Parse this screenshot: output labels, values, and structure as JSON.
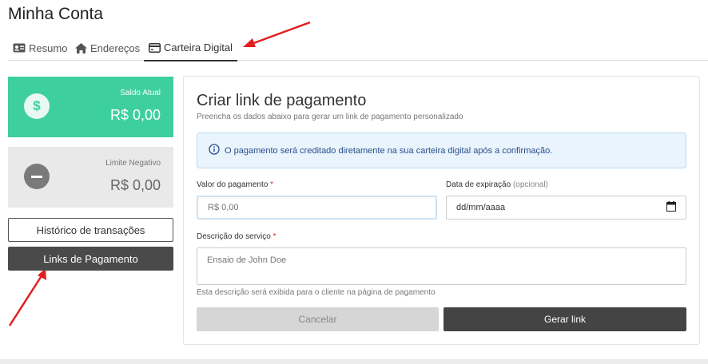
{
  "page": {
    "title": "Minha Conta"
  },
  "tabs": [
    {
      "label": "Resumo",
      "icon": "id-card-icon"
    },
    {
      "label": "Endereços",
      "icon": "home-icon"
    },
    {
      "label": "Carteira Digital",
      "icon": "credit-card-icon",
      "active": true
    }
  ],
  "balance": {
    "current": {
      "label": "Saldo Atual",
      "value": "R$ 0,00",
      "icon": "dollar-icon",
      "color": "#3ecf9f"
    },
    "negative": {
      "label": "Limite Negativo",
      "value": "R$ 0,00",
      "icon": "minus-icon",
      "color": "#e9e9e9"
    }
  },
  "sidebar": {
    "history_label": "Histórico de transações",
    "links_label": "Links de Pagamento"
  },
  "form": {
    "title": "Criar link de pagamento",
    "subtitle": "Preencha os dados abaixo para gerar um link de pagamento personalizado",
    "info": "O pagamento será creditado diretamente na sua carteira digital após a confirmação.",
    "amount": {
      "label": "Valor do pagamento",
      "required_mark": "*",
      "placeholder": "R$ 0,00"
    },
    "expiration": {
      "label": "Data de expiração",
      "optional": "(opcional)",
      "placeholder": "dd/mm/aaaa"
    },
    "description": {
      "label": "Descrição do serviço",
      "required_mark": "*",
      "placeholder": "Ensaio de John Doe",
      "help": "Esta descrição será exibida para o cliente na página de pagamento"
    },
    "cancel_label": "Cancelar",
    "generate_label": "Gerar link"
  },
  "colors": {
    "accent_green": "#3ecf9f",
    "dark_button": "#444444",
    "info_bg": "#e9f4fd",
    "annotation_arrow": "#e02020"
  }
}
